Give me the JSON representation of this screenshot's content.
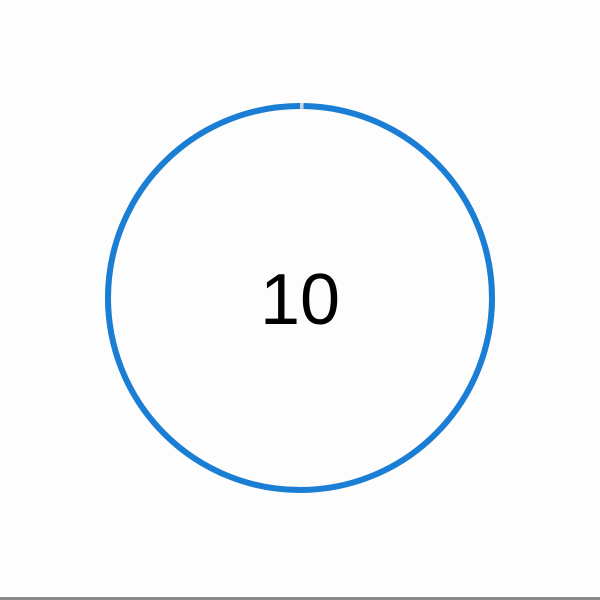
{
  "countdown": {
    "value": "10",
    "progress_elapsed_fraction": 0.003
  },
  "colors": {
    "background": "#fdfdfd",
    "ring_progress": "#1a7fd4",
    "ring_elapsed": "#c9d3dc",
    "text": "#000000",
    "divider": "#8a8a8a"
  }
}
